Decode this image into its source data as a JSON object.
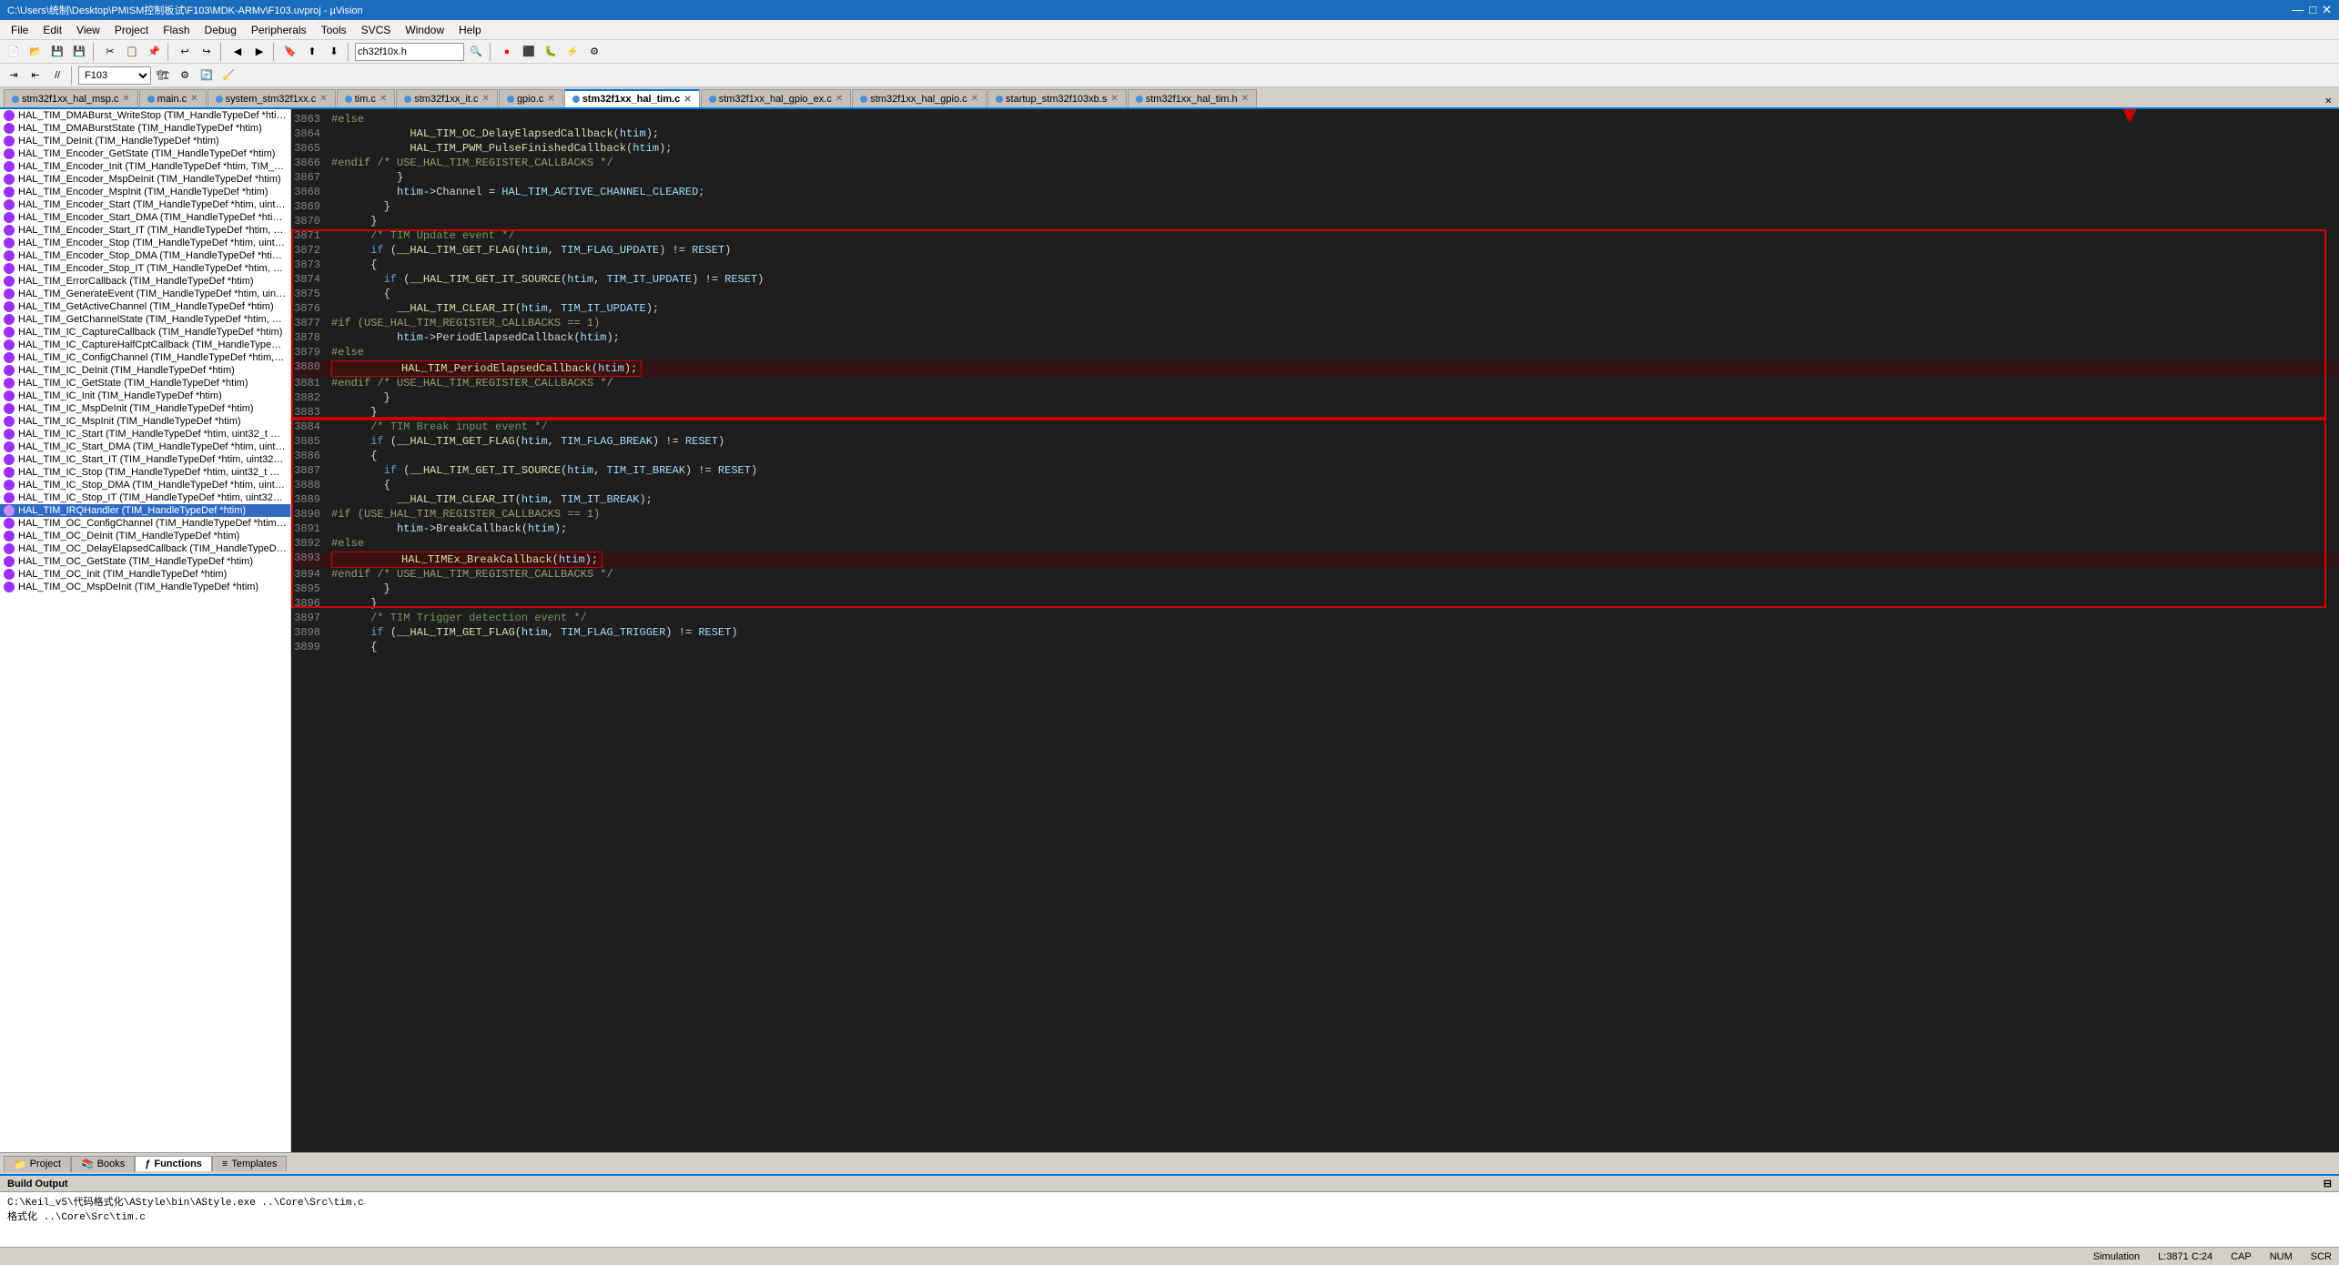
{
  "titlebar": {
    "text": "C:\\Users\\统制\\Desktop\\PMISM控制板试\\F103\\MDK-ARMv\\F103.uvproj - µVision",
    "buttons": [
      "—",
      "□",
      "✕"
    ]
  },
  "menubar": {
    "items": [
      "File",
      "Edit",
      "View",
      "Project",
      "Flash",
      "Debug",
      "Peripherals",
      "Tools",
      "SVCS",
      "Window",
      "Help"
    ]
  },
  "tabs": [
    {
      "label": "stm32f1xx_hal_msp.c",
      "active": false,
      "color": "#4a90d9"
    },
    {
      "label": "main.c",
      "active": false,
      "color": "#4a90d9"
    },
    {
      "label": "system_stm32f1xx.c",
      "active": false,
      "color": "#4a90d9"
    },
    {
      "label": "tim.c",
      "active": false,
      "color": "#4a90d9"
    },
    {
      "label": "stm32f1xx_it.c",
      "active": false,
      "color": "#4a90d9"
    },
    {
      "label": "gpio.c",
      "active": false,
      "color": "#4a90d9"
    },
    {
      "label": "stm32f1xx_hal_tim.c",
      "active": true,
      "color": "#4a90d9"
    },
    {
      "label": "stm32f1xx_hal_gpio_ex.c",
      "active": false,
      "color": "#4a90d9"
    },
    {
      "label": "stm32f1xx_hal_gpio.c",
      "active": false,
      "color": "#4a90d9"
    },
    {
      "label": "startup_stm32f103xb.s",
      "active": false,
      "color": "#4a90d9"
    },
    {
      "label": "stm32f1xx_hal_tim.h",
      "active": false,
      "color": "#4a90d9"
    }
  ],
  "functions_panel": {
    "items": [
      "HAL_TIM_DMABurst_WriteStop (TIM_HandleTypeDef *htim, *",
      "HAL_TIM_DMABurstState (TIM_HandleTypeDef *htim)",
      "HAL_TIM_DeInit (TIM_HandleTypeDef *htim)",
      "HAL_TIM_Encoder_GetState (TIM_HandleTypeDef *htim)",
      "HAL_TIM_Encoder_Init (TIM_HandleTypeDef *htim, TIM_Encc",
      "HAL_TIM_Encoder_MspDeInit (TIM_HandleTypeDef *htim)",
      "HAL_TIM_Encoder_MspInit (TIM_HandleTypeDef *htim)",
      "HAL_TIM_Encoder_Start (TIM_HandleTypeDef *htim, uint32_t",
      "HAL_TIM_Encoder_Start_DMA (TIM_HandleTypeDef *htim, ui",
      "HAL_TIM_Encoder_Start_IT (TIM_HandleTypeDef *htim, uint3",
      "HAL_TIM_Encoder_Stop (TIM_HandleTypeDef *htim, uint32_t",
      "HAL_TIM_Encoder_Stop_DMA (TIM_HandleTypeDef *htim, ui",
      "HAL_TIM_Encoder_Stop_IT (TIM_HandleTypeDef *htim, uint3",
      "HAL_TIM_ErrorCallback (TIM_HandleTypeDef *htim)",
      "HAL_TIM_GenerateEvent (TIM_HandleTypeDef *htim, uint32_",
      "HAL_TIM_GetActiveChannel (TIM_HandleTypeDef *htim)",
      "HAL_TIM_GetChannelState (TIM_HandleTypeDef *htim, uint3",
      "HAL_TIM_IC_CaptureCallback (TIM_HandleTypeDef *htim)",
      "HAL_TIM_IC_CaptureHalfCptCallback (TIM_HandleTypeDef *",
      "HAL_TIM_IC_ConfigChannel (TIM_HandleTypeDef *htim, TIM",
      "HAL_TIM_IC_DeInit (TIM_HandleTypeDef *htim)",
      "HAL_TIM_IC_GetState (TIM_HandleTypeDef *htim)",
      "HAL_TIM_IC_Init (TIM_HandleTypeDef *htim)",
      "HAL_TIM_IC_MspDeInit (TIM_HandleTypeDef *htim)",
      "HAL_TIM_IC_MspInit (TIM_HandleTypeDef *htim)",
      "HAL_TIM_IC_Start (TIM_HandleTypeDef *htim, uint32_t Chant",
      "HAL_TIM_IC_Start_DMA (TIM_HandleTypeDef *htim, uint32_t",
      "HAL_TIM_IC_Start_IT (TIM_HandleTypeDef *htim, uint32_t Ch",
      "HAL_TIM_IC_Stop (TIM_HandleTypeDef *htim, uint32_t Chanu",
      "HAL_TIM_IC_Stop_DMA (TIM_HandleTypeDef *htim, uint32_t",
      "HAL_TIM_IC_Stop_IT (TIM_HandleTypeDef *htim, uint32_t Ch",
      "HAL_TIM_IRQHandler (TIM_HandleTypeDef *htim)",
      "HAL_TIM_OC_ConfigChannel (TIM_HandleTypeDef *htim, TIM",
      "HAL_TIM_OC_DeInit (TIM_HandleTypeDef *htim)",
      "HAL_TIM_OC_DelayElapsedCallback (TIM_HandleTypeDef *h",
      "HAL_TIM_OC_GetState (TIM_HandleTypeDef *htim)",
      "HAL_TIM_OC_Init (TIM_HandleTypeDef *htim)",
      "HAL_TIM_OC_MspDeInit (TIM_HandleTypeDef *htim)"
    ],
    "selected_index": 31
  },
  "code": {
    "lines": [
      {
        "num": 3863,
        "content": "#else",
        "type": "preprocessor"
      },
      {
        "num": 3864,
        "content": "            HAL_TIM_OC_DelayElapsedCallback(htim);",
        "type": "code"
      },
      {
        "num": 3865,
        "content": "            HAL_TIM_PWM_PulseFinishedCallback(htim);",
        "type": "code"
      },
      {
        "num": 3866,
        "content": "#endif /* USE_HAL_TIM_REGISTER_CALLBACKS */",
        "type": "preprocessor"
      },
      {
        "num": 3867,
        "content": "          }",
        "type": "code"
      },
      {
        "num": 3868,
        "content": "          htim->Channel = HAL_TIM_ACTIVE_CHANNEL_CLEARED;",
        "type": "code"
      },
      {
        "num": 3869,
        "content": "        }",
        "type": "code"
      },
      {
        "num": 3870,
        "content": "      }",
        "type": "code"
      },
      {
        "num": 3871,
        "content": "      /* TIM Update event */",
        "type": "comment"
      },
      {
        "num": 3872,
        "content": "      if (__HAL_TIM_GET_FLAG(htim, TIM_FLAG_UPDATE) != RESET)",
        "type": "code"
      },
      {
        "num": 3873,
        "content": "      {",
        "type": "code"
      },
      {
        "num": 3874,
        "content": "        if (__HAL_TIM_GET_IT_SOURCE(htim, TIM_IT_UPDATE) != RESET)",
        "type": "code"
      },
      {
        "num": 3875,
        "content": "        {",
        "type": "code"
      },
      {
        "num": 3876,
        "content": "          __HAL_TIM_CLEAR_IT(htim, TIM_IT_UPDATE);",
        "type": "code"
      },
      {
        "num": 3877,
        "content": "#if (USE_HAL_TIM_REGISTER_CALLBACKS == 1)",
        "type": "preprocessor"
      },
      {
        "num": 3878,
        "content": "          htim->PeriodElapsedCallback(htim);",
        "type": "code"
      },
      {
        "num": 3879,
        "content": "#else",
        "type": "preprocessor"
      },
      {
        "num": 3880,
        "content": "          HAL_TIM_PeriodElapsedCallback(htim);",
        "type": "code_highlight1"
      },
      {
        "num": 3881,
        "content": "#endif /* USE_HAL_TIM_REGISTER_CALLBACKS */",
        "type": "preprocessor"
      },
      {
        "num": 3882,
        "content": "        }",
        "type": "code"
      },
      {
        "num": 3883,
        "content": "      }",
        "type": "code"
      },
      {
        "num": 3884,
        "content": "      /* TIM Break input event */",
        "type": "comment"
      },
      {
        "num": 3885,
        "content": "      if (__HAL_TIM_GET_FLAG(htim, TIM_FLAG_BREAK) != RESET)",
        "type": "code"
      },
      {
        "num": 3886,
        "content": "      {",
        "type": "code"
      },
      {
        "num": 3887,
        "content": "        if (__HAL_TIM_GET_IT_SOURCE(htim, TIM_IT_BREAK) != RESET)",
        "type": "code"
      },
      {
        "num": 3888,
        "content": "        {",
        "type": "code"
      },
      {
        "num": 3889,
        "content": "          __HAL_TIM_CLEAR_IT(htim, TIM_IT_BREAK);",
        "type": "code"
      },
      {
        "num": 3890,
        "content": "#if (USE_HAL_TIM_REGISTER_CALLBACKS == 1)",
        "type": "preprocessor"
      },
      {
        "num": 3891,
        "content": "          htim->BreakCallback(htim);",
        "type": "code"
      },
      {
        "num": 3892,
        "content": "#else",
        "type": "preprocessor"
      },
      {
        "num": 3893,
        "content": "          HAL_TIMEx_BreakCallback(htim);",
        "type": "code_highlight2"
      },
      {
        "num": 3894,
        "content": "#endif /* USE_HAL_TIM_REGISTER_CALLBACKS */",
        "type": "preprocessor"
      },
      {
        "num": 3895,
        "content": "        }",
        "type": "code"
      },
      {
        "num": 3896,
        "content": "      }",
        "type": "code"
      },
      {
        "num": 3897,
        "content": "      /* TIM Trigger detection event */",
        "type": "comment"
      },
      {
        "num": 3898,
        "content": "      if (__HAL_TIM_GET_FLAG(htim, TIM_FLAG_TRIGGER) != RESET)",
        "type": "code"
      },
      {
        "num": 3899,
        "content": "      {",
        "type": "code"
      }
    ]
  },
  "bottom_tabs": [
    {
      "label": "Project",
      "icon": "📁",
      "active": false
    },
    {
      "label": "Books",
      "icon": "📚",
      "active": false
    },
    {
      "label": "Functions",
      "icon": "ƒ",
      "active": true
    },
    {
      "label": "Templates",
      "icon": "≡",
      "active": false
    }
  ],
  "build_output": {
    "header": "Build Output",
    "lines": [
      "C:\\Keil_v5\\代码格式化\\AStyle\\bin\\AStyle.exe ..\\Core\\Src\\tim.c",
      "格式化 ..\\Core\\Src\\tim.c"
    ]
  },
  "statusbar": {
    "mode": "Simulation",
    "position": "L:3871 C:24",
    "caps": "CAP",
    "num": "NUM",
    "extra": "SCR"
  },
  "toolbar_combo": "F103"
}
